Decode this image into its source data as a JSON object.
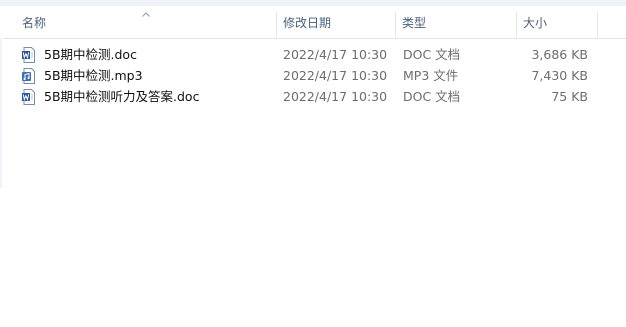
{
  "columns": {
    "name": "名称",
    "date": "修改日期",
    "type": "类型",
    "size": "大小"
  },
  "files": [
    {
      "name": "5B期中检测.doc",
      "date": "2022/4/17 10:30",
      "type": "DOC 文档",
      "size": "3,686 KB",
      "icon": "word-doc-icon"
    },
    {
      "name": "5B期中检测.mp3",
      "date": "2022/4/17 10:30",
      "type": "MP3 文件",
      "size": "7,430 KB",
      "icon": "audio-file-icon"
    },
    {
      "name": "5B期中检测听力及答案.doc",
      "date": "2022/4/17 10:30",
      "type": "DOC 文档",
      "size": "75 KB",
      "icon": "word-doc-icon"
    }
  ],
  "colors": {
    "header_text": "#4c607a",
    "word_icon_blue": "#2b5797",
    "audio_icon_blue": "#3c6fb4"
  }
}
